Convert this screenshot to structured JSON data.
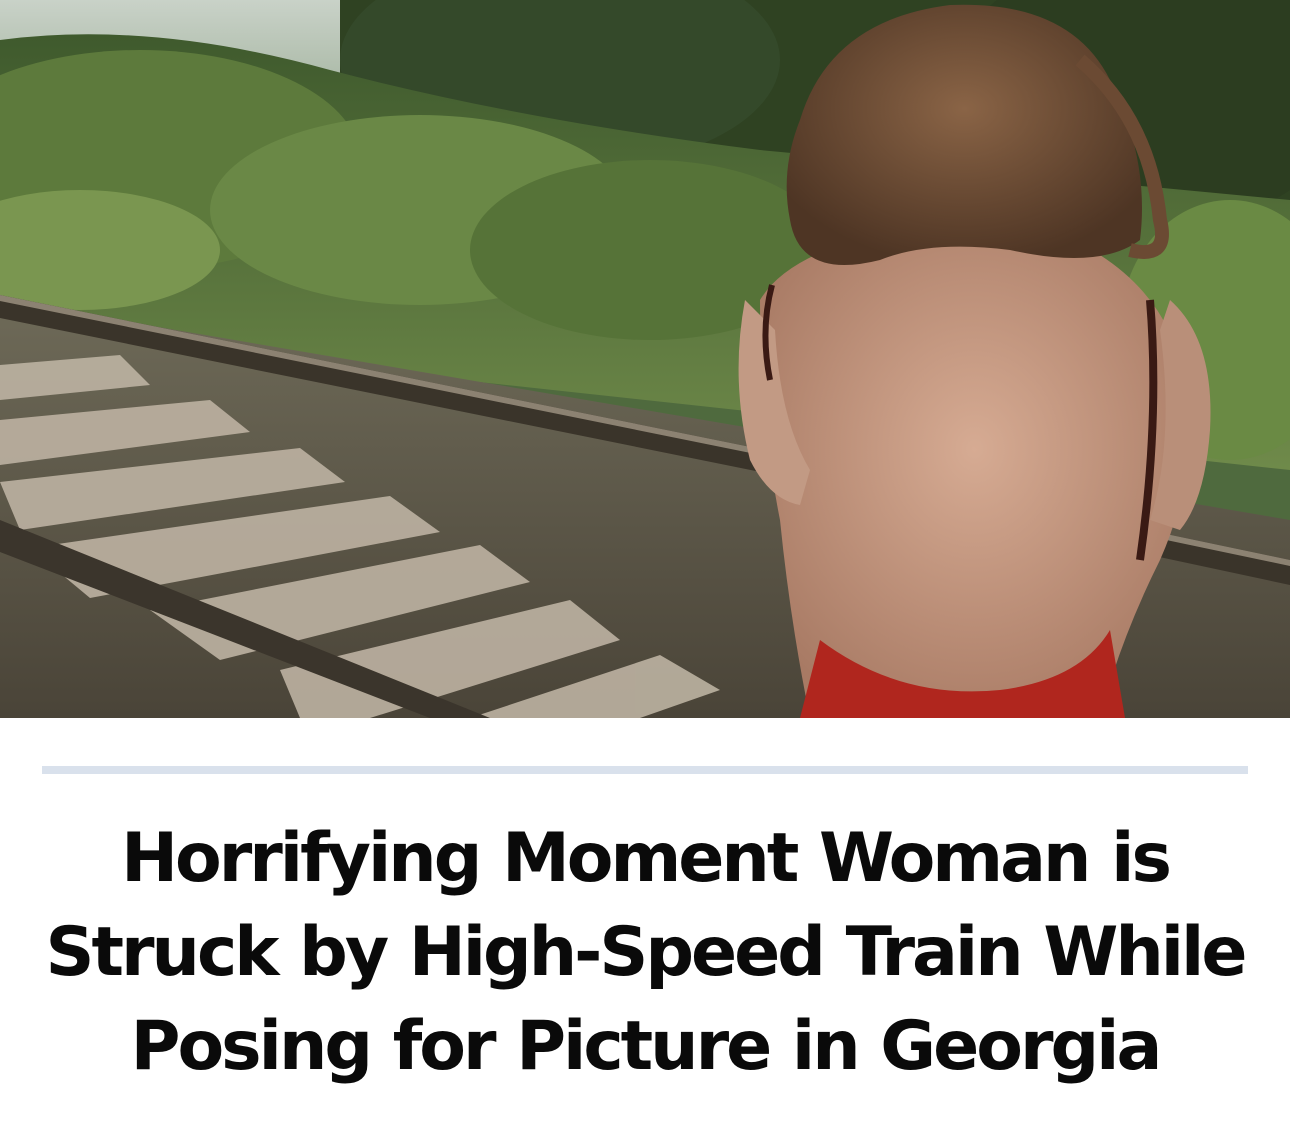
{
  "article": {
    "headline": "Horrifying Moment Woman is Struck by High-Speed Train While Posing for Picture in Georgia"
  },
  "hero_image": {
    "subject": "woman-on-railway-track"
  },
  "colors": {
    "background": "#ffffff",
    "divider": "#d9e1ec",
    "headline_text": "#0a0a0a"
  }
}
